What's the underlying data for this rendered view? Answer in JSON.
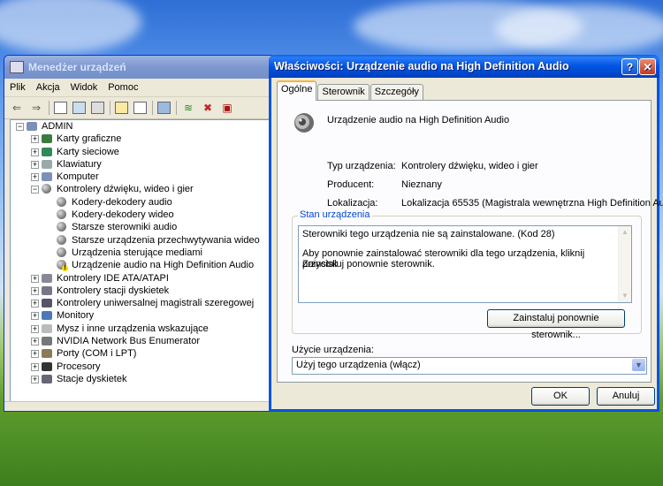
{
  "device_manager": {
    "title": "Menedżer urządzeń",
    "menu": [
      "Plik",
      "Akcja",
      "Widok",
      "Pomoc"
    ],
    "toolbar_icons": [
      "back-arrow-icon",
      "forward-arrow-icon",
      "view-icon",
      "properties-icon",
      "print-icon",
      "help-icon",
      "view-devices-icon",
      "monitor-icon",
      "scan-hardware-icon",
      "disable-device-icon",
      "uninstall-device-icon"
    ],
    "tree": [
      {
        "label": "ADMIN",
        "level": 0,
        "expander": "−",
        "icon": "computer-icon"
      },
      {
        "label": "Karty graficzne",
        "level": 1,
        "expander": "+",
        "icon": "display-adapter-icon"
      },
      {
        "label": "Karty sieciowe",
        "level": 1,
        "expander": "+",
        "icon": "network-adapter-icon"
      },
      {
        "label": "Klawiatury",
        "level": 1,
        "expander": "+",
        "icon": "keyboard-icon"
      },
      {
        "label": "Komputer",
        "level": 1,
        "expander": "+",
        "icon": "computer-icon"
      },
      {
        "label": "Kontrolery dźwięku, wideo i gier",
        "level": 1,
        "expander": "−",
        "icon": "speaker-icon"
      },
      {
        "label": "Kodery-dekodery audio",
        "level": 2,
        "icon": "speaker-icon"
      },
      {
        "label": "Kodery-dekodery wideo",
        "level": 2,
        "icon": "speaker-icon"
      },
      {
        "label": "Starsze sterowniki audio",
        "level": 2,
        "icon": "speaker-icon"
      },
      {
        "label": "Starsze urządzenia przechwytywania wideo",
        "level": 2,
        "icon": "speaker-icon"
      },
      {
        "label": "Urządzenia sterujące mediami",
        "level": 2,
        "icon": "speaker-icon"
      },
      {
        "label": "Urządzenie audio na High Definition Audio",
        "level": 2,
        "icon": "speaker-icon",
        "warning": true
      },
      {
        "label": "Kontrolery IDE ATA/ATAPI",
        "level": 1,
        "expander": "+",
        "icon": "ide-controller-icon"
      },
      {
        "label": "Kontrolery stacji dyskietek",
        "level": 1,
        "expander": "+",
        "icon": "floppy-controller-icon"
      },
      {
        "label": "Kontrolery uniwersalnej magistrali szeregowej",
        "level": 1,
        "expander": "+",
        "icon": "usb-icon"
      },
      {
        "label": "Monitory",
        "level": 1,
        "expander": "+",
        "icon": "monitor-icon"
      },
      {
        "label": "Mysz i inne urządzenia wskazujące",
        "level": 1,
        "expander": "+",
        "icon": "mouse-icon"
      },
      {
        "label": "NVIDIA Network Bus Enumerator",
        "level": 1,
        "expander": "+",
        "icon": "bus-enumerator-icon"
      },
      {
        "label": "Porty (COM i LPT)",
        "level": 1,
        "expander": "+",
        "icon": "port-icon"
      },
      {
        "label": "Procesory",
        "level": 1,
        "expander": "+",
        "icon": "processor-icon"
      },
      {
        "label": "Stacje dyskietek",
        "level": 1,
        "expander": "+",
        "icon": "floppy-drive-icon"
      }
    ]
  },
  "dialog": {
    "title": "Właściwości: Urządzenie audio na High Definition Audio",
    "tabs": [
      "Ogólne",
      "Sterownik",
      "Szczegóły"
    ],
    "device_name": "Urządzenie audio na High Definition Audio",
    "fields": [
      {
        "key": "Typ urządzenia:",
        "value": "Kontrolery dźwięku, wideo i gier"
      },
      {
        "key": "Producent:",
        "value": "Nieznany"
      },
      {
        "key": "Lokalizacja:",
        "value": "Lokalizacja 65535 (Magistrala wewnętrzna High Definition Audio)"
      }
    ],
    "status_group_label": "Stan urządzenia",
    "status_line1": "Sterowniki tego urządzenia nie są zainstalowane. (Kod 28)",
    "status_line2": "Aby ponownie zainstalować sterowniki dla tego urządzenia, kliknij przycisk",
    "status_line3": "Zainstaluj ponownie sterownik.",
    "reinstall_button": "Zainstaluj ponownie sterownik...",
    "usage_label": "Użycie urządzenia:",
    "usage_value": "Użyj tego urządzenia (włącz)",
    "ok_button": "OK",
    "cancel_button": "Anuluj",
    "help_button": "?",
    "close_button": "✕"
  }
}
